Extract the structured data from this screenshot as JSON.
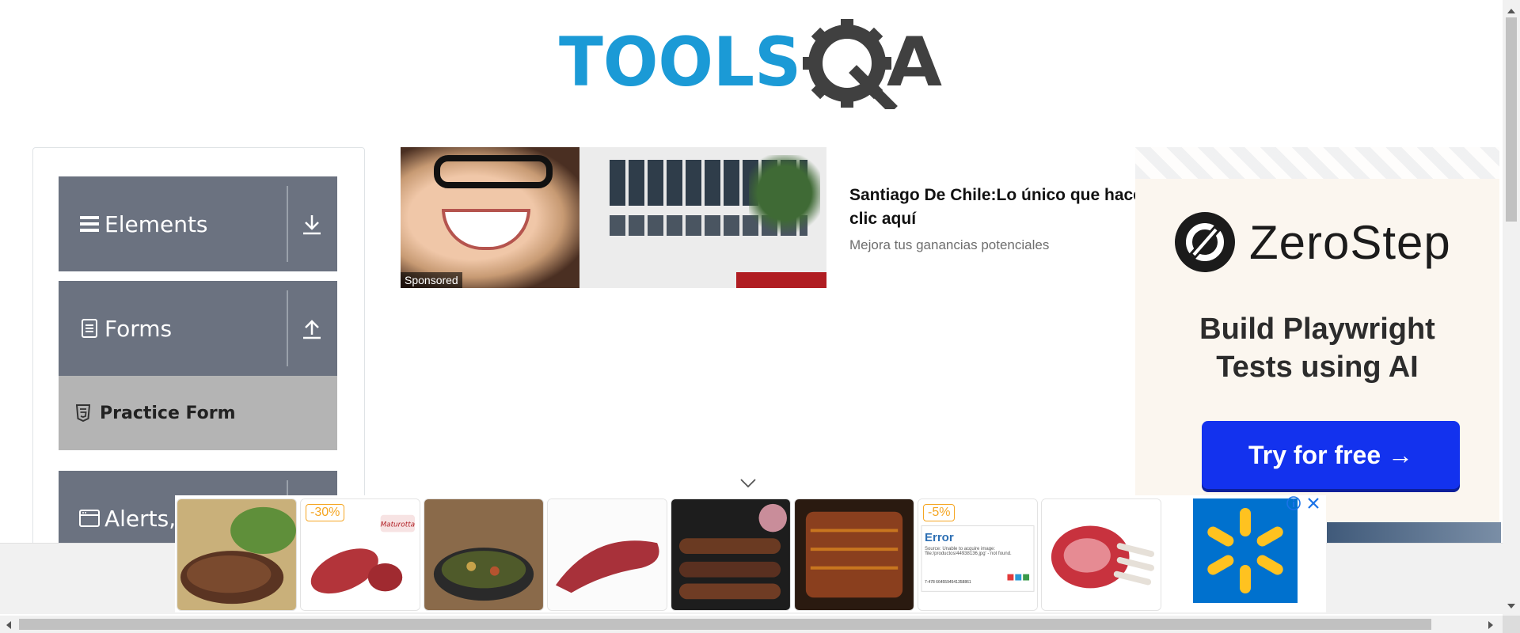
{
  "header": {
    "logo_text_left": "TOOLS",
    "logo_text_right": "A"
  },
  "sidebar": {
    "groups": [
      {
        "label": "Elements",
        "icon": "hamburger-icon",
        "toggle_icon": "download-icon"
      },
      {
        "label": "Forms",
        "icon": "document-icon",
        "toggle_icon": "upload-icon"
      },
      {
        "label": "Alerts,",
        "icon": "window-icon"
      }
    ],
    "items": [
      {
        "label": "Practice Form",
        "icon": "html5-icon"
      }
    ]
  },
  "ad_sponsored": {
    "badge": "Sponsored",
    "title": "Santiago De Chile:Lo único que hacer clic aquí",
    "subtitle": "Mejora tus ganancias potenciales"
  },
  "ad_zerostep": {
    "brand": "ZeroStep",
    "tagline_line1": "Build Playwright",
    "tagline_line2": "Tests using AI",
    "cta": "Try for free →"
  },
  "shelf": {
    "products": [
      {
        "discount": ""
      },
      {
        "discount": "-30%",
        "brand": "Maturotta"
      },
      {
        "discount": ""
      },
      {
        "discount": ""
      },
      {
        "discount": ""
      },
      {
        "discount": ""
      },
      {
        "discount": "-5%",
        "error_title": "Error",
        "error_text": "Source: Unable to acquire image: 'file:/productos/44938136.jpg' - not found.",
        "error_code": "7-478 6645594541358861"
      },
      {
        "discount": ""
      }
    ],
    "colors": {
      "discount": "#f5a623",
      "walmart_blue": "#0071ce",
      "walmart_yellow": "#ffc220"
    }
  },
  "colors": {
    "logo_blue": "#1b9ad6",
    "logo_gray": "#404040",
    "sidebar_header": "#6b7280",
    "sidebar_item_active": "#b4b4b4",
    "zerostep_cta": "#1332ee"
  }
}
